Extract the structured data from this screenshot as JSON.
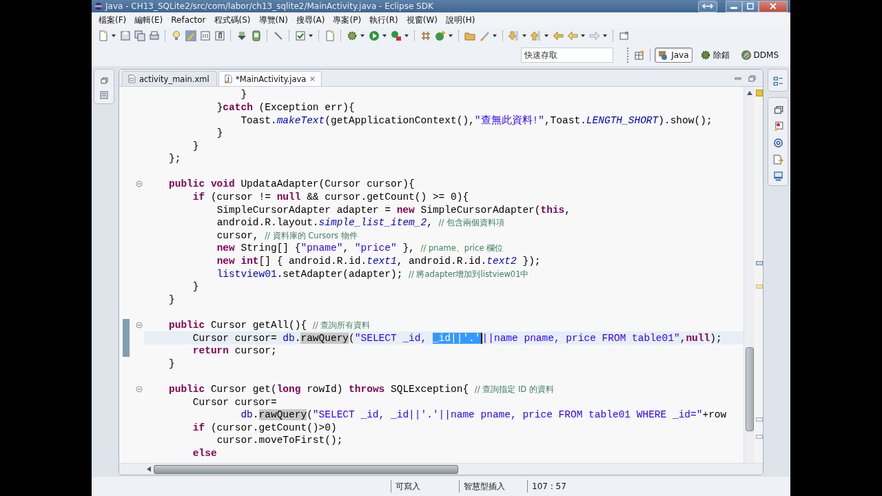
{
  "window": {
    "title": "Java - CH13_SQLite2/src/com/labor/ch13_sqlite2/MainActivity.java - Eclipse SDK"
  },
  "menu": [
    "檔案(F)",
    "編輯(E)",
    "Refactor",
    "程式碼(S)",
    "導覽(N)",
    "搜尋(A)",
    "專案(P)",
    "執行(R)",
    "視窗(W)",
    "說明(H)"
  ],
  "quick_access": {
    "placeholder": "快速存取"
  },
  "perspectives": [
    {
      "label": "Java",
      "selected": true
    },
    {
      "label": "除錯",
      "selected": false
    },
    {
      "label": "DDMS",
      "selected": false
    }
  ],
  "editor_tabs": [
    {
      "label": "activity_main.xml",
      "selected": false
    },
    {
      "label": "*MainActivity.java",
      "selected": true
    }
  ],
  "code_lines": [
    {
      "fold": false,
      "current": false,
      "range": false,
      "tokens": [
        {
          "kind": "plain",
          "text": "            }"
        }
      ]
    },
    {
      "fold": false,
      "current": false,
      "range": false,
      "tokens": [
        {
          "kind": "plain",
          "text": "        }"
        },
        {
          "kind": "keyword",
          "text": "catch"
        },
        {
          "kind": "plain",
          "text": " (Exception err){"
        }
      ]
    },
    {
      "fold": false,
      "current": false,
      "range": false,
      "tokens": [
        {
          "kind": "plain",
          "text": "            Toast."
        },
        {
          "kind": "static",
          "text": "makeText"
        },
        {
          "kind": "plain",
          "text": "(getApplicationContext(),"
        },
        {
          "kind": "string",
          "text": "\"查無此資料!\""
        },
        {
          "kind": "plain",
          "text": ",Toast."
        },
        {
          "kind": "static",
          "text": "LENGTH_SHORT"
        },
        {
          "kind": "plain",
          "text": ").show();"
        }
      ]
    },
    {
      "fold": false,
      "current": false,
      "range": false,
      "tokens": [
        {
          "kind": "plain",
          "text": "        }"
        }
      ]
    },
    {
      "fold": false,
      "current": false,
      "range": false,
      "tokens": [
        {
          "kind": "plain",
          "text": "    }"
        }
      ]
    },
    {
      "fold": false,
      "current": false,
      "range": false,
      "tokens": [
        {
          "kind": "plain",
          "text": "};"
        }
      ]
    },
    {
      "fold": false,
      "current": false,
      "range": false
    },
    {
      "fold": true,
      "current": false,
      "range": false,
      "tokens": [
        {
          "kind": "keyword",
          "text": "public void"
        },
        {
          "kind": "plain",
          "text": " UpdataAdapter(Cursor cursor){"
        }
      ]
    },
    {
      "fold": false,
      "current": false,
      "range": false,
      "tokens": [
        {
          "kind": "keyword",
          "text": "    if"
        },
        {
          "kind": "plain",
          "text": " (cursor != "
        },
        {
          "kind": "keyword",
          "text": "null"
        },
        {
          "kind": "plain",
          "text": " && cursor.getCount() >= 0){"
        }
      ]
    },
    {
      "fold": false,
      "current": false,
      "range": false,
      "tokens": [
        {
          "kind": "plain",
          "text": "        SimpleCursorAdapter adapter = "
        },
        {
          "kind": "keyword",
          "text": "new"
        },
        {
          "kind": "plain",
          "text": " SimpleCursorAdapter("
        },
        {
          "kind": "keyword",
          "text": "this"
        },
        {
          "kind": "plain",
          "text": ","
        }
      ]
    },
    {
      "fold": false,
      "current": false,
      "range": false,
      "tokens": [
        {
          "kind": "plain",
          "text": "        android.R.layout."
        },
        {
          "kind": "static",
          "text": "simple_list_item_2"
        },
        {
          "kind": "plain",
          "text": ", "
        },
        {
          "kind": "comment",
          "text": "// 包含兩個資料項"
        }
      ]
    },
    {
      "fold": false,
      "current": false,
      "range": false,
      "tokens": [
        {
          "kind": "plain",
          "text": "        cursor, "
        },
        {
          "kind": "comment",
          "text": "// 資料庫的 Cursors 物件"
        }
      ]
    },
    {
      "fold": false,
      "current": false,
      "range": false,
      "tokens": [
        {
          "kind": "keyword",
          "text": "        new"
        },
        {
          "kind": "plain",
          "text": " String[] {"
        },
        {
          "kind": "string",
          "text": "\"pname\""
        },
        {
          "kind": "plain",
          "text": ", "
        },
        {
          "kind": "string",
          "text": "\"price\""
        },
        {
          "kind": "plain",
          "text": " }, "
        },
        {
          "kind": "comment",
          "text": "// pname、price 欄位"
        }
      ]
    },
    {
      "fold": false,
      "current": false,
      "range": false,
      "tokens": [
        {
          "kind": "keyword",
          "text": "        new int"
        },
        {
          "kind": "plain",
          "text": "[] { android.R.id."
        },
        {
          "kind": "static",
          "text": "text1"
        },
        {
          "kind": "plain",
          "text": ", android.R.id."
        },
        {
          "kind": "static",
          "text": "text2"
        },
        {
          "kind": "plain",
          "text": " });"
        }
      ]
    },
    {
      "fold": false,
      "current": false,
      "range": false,
      "tokens": [
        {
          "kind": "field",
          "text": "        listview01"
        },
        {
          "kind": "plain",
          "text": ".setAdapter(adapter); "
        },
        {
          "kind": "comment",
          "text": "// 將adapter增加到listview01中"
        }
      ]
    },
    {
      "fold": false,
      "current": false,
      "range": false,
      "tokens": [
        {
          "kind": "plain",
          "text": "    }"
        }
      ]
    },
    {
      "fold": false,
      "current": false,
      "range": false,
      "tokens": [
        {
          "kind": "plain",
          "text": "}"
        }
      ]
    },
    {
      "fold": false,
      "current": false,
      "range": false
    },
    {
      "fold": true,
      "current": false,
      "range": true,
      "tokens": [
        {
          "kind": "keyword",
          "text": "public"
        },
        {
          "kind": "plain",
          "text": " Cursor getAll(){ "
        },
        {
          "kind": "comment",
          "text": "// 查詢所有資料"
        }
      ]
    },
    {
      "fold": false,
      "current": true,
      "range": true,
      "tokens": [
        {
          "kind": "plain",
          "text": "    Cursor cursor= "
        },
        {
          "kind": "field",
          "text": "db"
        },
        {
          "kind": "plain",
          "text": "."
        },
        {
          "kind": "occurrence",
          "text": "rawQuery"
        },
        {
          "kind": "plain",
          "text": "("
        },
        {
          "kind": "string",
          "text": "\"SELECT _id, "
        },
        {
          "kind": "selected",
          "text": "_id||'.'"
        },
        {
          "kind": "string",
          "text": "||name pname, price FROM table01\""
        },
        {
          "kind": "plain",
          "text": ","
        },
        {
          "kind": "keyword",
          "text": "null"
        },
        {
          "kind": "plain",
          "text": ");"
        }
      ]
    },
    {
      "fold": false,
      "current": false,
      "range": true,
      "tokens": [
        {
          "kind": "keyword",
          "text": "    return"
        },
        {
          "kind": "plain",
          "text": " cursor;"
        }
      ]
    },
    {
      "fold": false,
      "current": false,
      "range": false,
      "tokens": [
        {
          "kind": "plain",
          "text": "}"
        }
      ]
    },
    {
      "fold": false,
      "current": false,
      "range": false
    },
    {
      "fold": true,
      "current": false,
      "range": false,
      "tokens": [
        {
          "kind": "keyword",
          "text": "public"
        },
        {
          "kind": "plain",
          "text": " Cursor get("
        },
        {
          "kind": "keyword",
          "text": "long"
        },
        {
          "kind": "plain",
          "text": " rowId) "
        },
        {
          "kind": "keyword",
          "text": "throws"
        },
        {
          "kind": "plain",
          "text": " SQLException{ "
        },
        {
          "kind": "comment",
          "text": "// 查詢指定 ID 的資料"
        }
      ]
    },
    {
      "fold": false,
      "current": false,
      "range": false,
      "tokens": [
        {
          "kind": "plain",
          "text": "    Cursor cursor="
        }
      ]
    },
    {
      "fold": false,
      "current": false,
      "range": false,
      "tokens": [
        {
          "kind": "field",
          "text": "            db"
        },
        {
          "kind": "plain",
          "text": "."
        },
        {
          "kind": "occurrence",
          "text": "rawQuery"
        },
        {
          "kind": "plain",
          "text": "("
        },
        {
          "kind": "string",
          "text": "\"SELECT _id, _id||'.'||name pname, price FROM table01 WHERE _id=\""
        },
        {
          "kind": "plain",
          "text": "+row"
        }
      ]
    },
    {
      "fold": false,
      "current": false,
      "range": false,
      "tokens": [
        {
          "kind": "keyword",
          "text": "    if"
        },
        {
          "kind": "plain",
          "text": " (cursor.getCount()>0)"
        }
      ]
    },
    {
      "fold": false,
      "current": false,
      "range": false,
      "tokens": [
        {
          "kind": "plain",
          "text": "        cursor.moveToFirst();"
        }
      ]
    },
    {
      "fold": false,
      "current": false,
      "range": false,
      "tokens": [
        {
          "kind": "keyword",
          "text": "    else"
        }
      ]
    }
  ],
  "status_bar": {
    "write_mode": "可寫入",
    "insert_mode": "智慧型插入",
    "position": "107 : 57"
  }
}
